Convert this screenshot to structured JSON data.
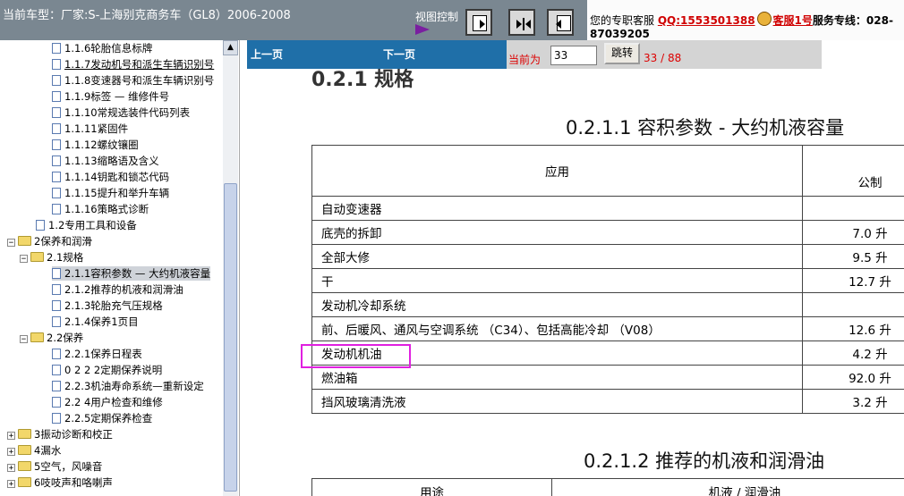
{
  "header": {
    "car_model": "当前车型：厂家:S-上海别克商务车（GL8）2006-2008",
    "view_control": "视图控制",
    "service": {
      "prefix": "您的专职客服",
      "qq": "QQ:1553501388",
      "agent": "客服1号",
      "hotline_label": "服务专线：",
      "hotline_part1": "028-",
      "hotline_part2": "87039205"
    }
  },
  "tree": {
    "items": [
      {
        "label": "1.1.6轮胎信息标牌",
        "kind": "doc",
        "indent": 3
      },
      {
        "label": "1.1.7发动机号和派生车辆识别号",
        "kind": "doc",
        "indent": 3
      },
      {
        "label": "1.1.8变速器号和派生车辆识别号",
        "kind": "doc",
        "indent": 3
      },
      {
        "label": "1.1.9标签 — 维修件号",
        "kind": "doc",
        "indent": 3
      },
      {
        "label": "1.1.10常规选装件代码列表",
        "kind": "doc",
        "indent": 3
      },
      {
        "label": "1.1.11紧固件",
        "kind": "doc",
        "indent": 3
      },
      {
        "label": "1.1.12螺纹镶圈",
        "kind": "doc",
        "indent": 3
      },
      {
        "label": "1.1.13缩略语及含义",
        "kind": "doc",
        "indent": 3
      },
      {
        "label": "1.1.14钥匙和锁芯代码",
        "kind": "doc",
        "indent": 3
      },
      {
        "label": "1.1.15提升和举升车辆",
        "kind": "doc",
        "indent": 3
      },
      {
        "label": "1.1.16策略式诊断",
        "kind": "doc",
        "indent": 3
      },
      {
        "label": "1.2专用工具和设备",
        "kind": "doc",
        "indent": 2
      },
      {
        "label": "2保养和润滑",
        "kind": "folder",
        "indent": 0
      },
      {
        "label": "2.1规格",
        "kind": "folder",
        "indent": 1
      },
      {
        "label": "2.1.1容积参数 — 大约机液容量",
        "kind": "doc",
        "indent": 3
      },
      {
        "label": "2.1.2推荐的机液和润滑油",
        "kind": "doc",
        "indent": 3
      },
      {
        "label": "2.1.3轮胎充气压规格",
        "kind": "doc",
        "indent": 3
      },
      {
        "label": "2.1.4保养1页目",
        "kind": "doc",
        "indent": 3
      },
      {
        "label": "2.2保养",
        "kind": "folder",
        "indent": 1
      },
      {
        "label": "2.2.1保养日程表",
        "kind": "doc",
        "indent": 3
      },
      {
        "label": "0 2 2 2定期保养说明",
        "kind": "doc",
        "indent": 3
      },
      {
        "label": "2.2.3机油寿命系统—重新设定",
        "kind": "doc",
        "indent": 3
      },
      {
        "label": "2.2 4用户检查和维修",
        "kind": "doc",
        "indent": 3
      },
      {
        "label": "2.2.5定期保养检查",
        "kind": "doc",
        "indent": 3
      },
      {
        "label": "3振动诊断和校正",
        "kind": "folder",
        "indent": 0
      },
      {
        "label": "4漏水",
        "kind": "folder",
        "indent": 0
      },
      {
        "label": "5空气，风噪音",
        "kind": "folder",
        "indent": 0
      },
      {
        "label": "6吱吱声和咯喇声",
        "kind": "folder",
        "indent": 0
      }
    ]
  },
  "nav": {
    "prev": "上一页",
    "next": "下一页",
    "current_label": "当前为",
    "current_page": "33",
    "jump": "跳转",
    "total": "33 / 88"
  },
  "document": {
    "heading": "0.2.1 规格",
    "section_title": "0.2.1.1 容积参数 - 大约机液容量",
    "col_application": "应用",
    "col_metric": "公制",
    "rows": [
      {
        "label": "自动变速器",
        "value": ""
      },
      {
        "label": "底壳的拆卸",
        "value": "7.0 升"
      },
      {
        "label": "全部大修",
        "value": "9.5 升"
      },
      {
        "label": "干",
        "value": "12.7 升"
      },
      {
        "label": "发动机冷却系统",
        "value": ""
      },
      {
        "label": "前、后暖风、通风与空调系统 （C34）、包括高能冷却 （V08）",
        "value": "12.6 升"
      },
      {
        "label": "发动机机油",
        "value": "4.2 升"
      },
      {
        "label": "燃油箱",
        "value": "92.0 升"
      },
      {
        "label": "挡风玻璃清洗液",
        "value": "3.2 升"
      }
    ],
    "section2_title": "0.2.1.2 推荐的机液和润滑油",
    "t2_col1": "用途",
    "t2_col2": "机液 / 润滑油"
  }
}
